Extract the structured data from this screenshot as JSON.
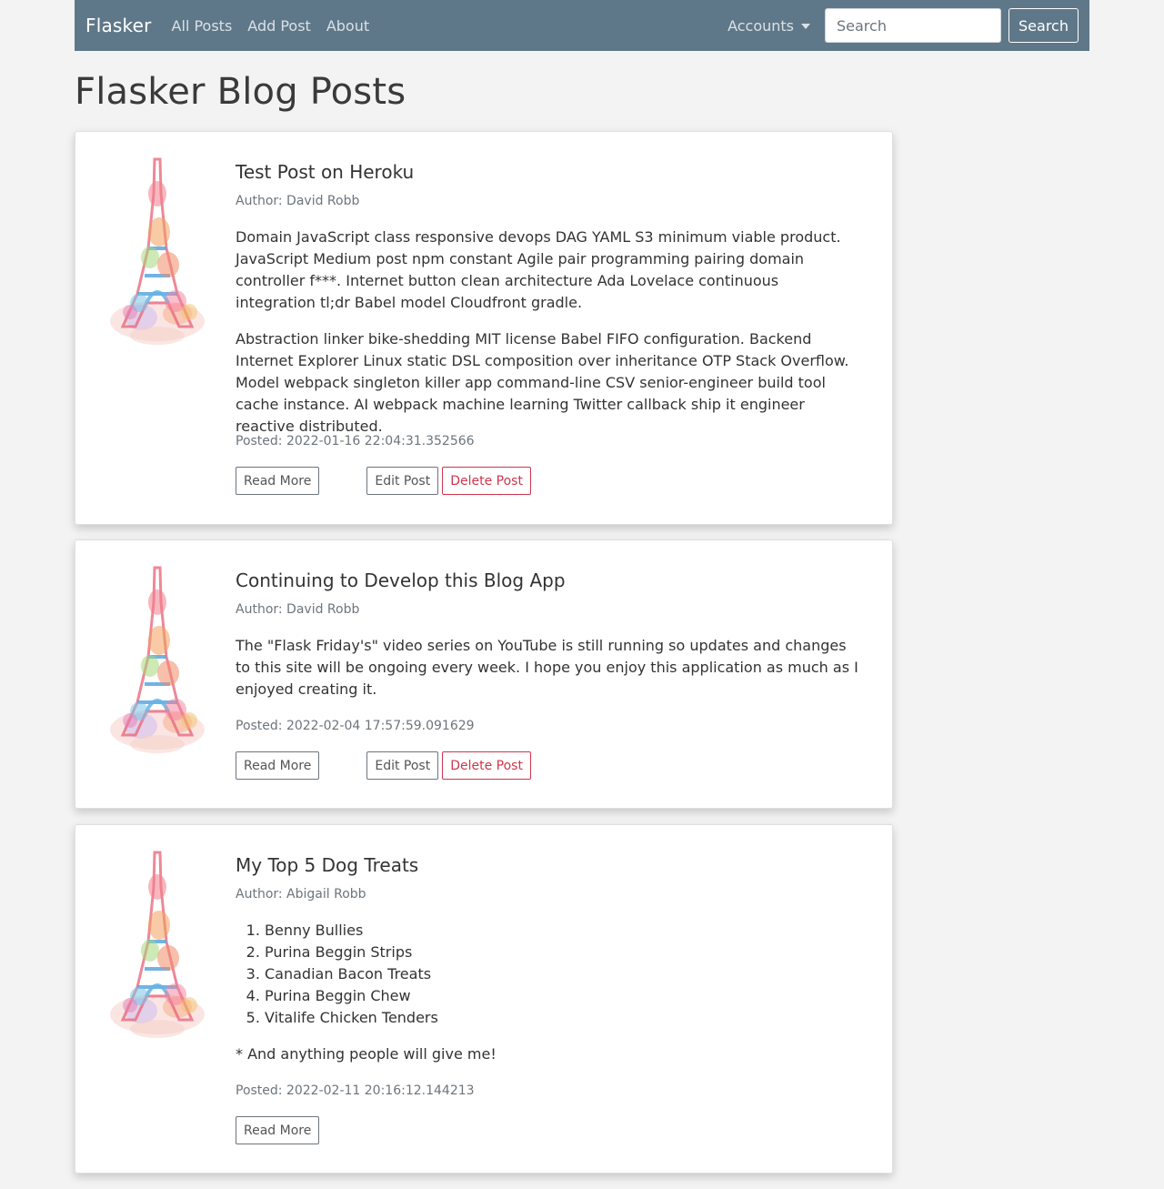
{
  "nav": {
    "brand": "Flasker",
    "links": [
      "All Posts",
      "Add Post",
      "About"
    ],
    "accounts": "Accounts",
    "search_placeholder": "Search",
    "search_button": "Search"
  },
  "page_title": "Flasker Blog Posts",
  "colors": {
    "navbar": "#5f7889",
    "delete": "#d0354c"
  },
  "posts": [
    {
      "title": "Test Post on Heroku",
      "author": "Author: David Robb",
      "paragraphs": [
        "Domain JavaScript class responsive devops DAG YAML S3 minimum viable product. JavaScript Medium post npm constant Agile pair programming pairing domain controller f***. Internet button clean architecture Ada Lovelace continuous integration tl;dr Babel model Cloudfront gradle.",
        "Abstraction linker bike-shedding MIT license Babel FIFO configuration. Backend Internet Explorer Linux static DSL composition over inheritance OTP Stack Overflow. Model webpack singleton killer app command-line CSV senior-engineer build tool cache instance. AI webpack machine learning Twitter callback ship it engineer reactive distributed."
      ],
      "posted": "Posted: 2022-01-16 22:04:31.352566",
      "read_more": "Read More",
      "edit": "Edit Post",
      "delete": "Delete Post"
    },
    {
      "title": "Continuing to Develop this Blog App",
      "author": "Author: David Robb",
      "paragraphs": [
        "The \"Flask Friday's\" video series on YouTube is still running so updates and changes to this site will be ongoing every week. I hope you enjoy this application as much as I enjoyed creating it."
      ],
      "posted": "Posted: 2022-02-04 17:57:59.091629",
      "read_more": "Read More",
      "edit": "Edit Post",
      "delete": "Delete Post"
    },
    {
      "title": "My Top 5 Dog Treats",
      "author": "Author: Abigail Robb",
      "list": [
        "Benny Bullies",
        "Purina Beggin Strips",
        "Canadian Bacon Treats",
        "Purina Beggin Chew",
        "Vitalife Chicken Tenders"
      ],
      "note": "* And anything people will give me!",
      "posted": "Posted: 2022-02-11 20:16:12.144213",
      "read_more": "Read More"
    }
  ]
}
